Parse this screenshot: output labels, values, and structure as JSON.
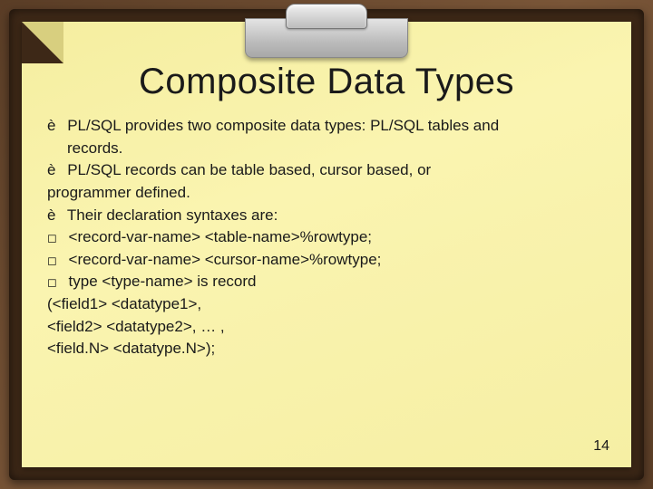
{
  "title": "Composite Data Types",
  "lines": {
    "l1a": "PL/SQL provides two composite data types: PL/SQL tables and",
    "l1b": "records.",
    "l2a": " PL/SQL records can be table based, cursor based, or",
    "l2b": "programmer defined.",
    "l3": "Their declaration syntaxes are:",
    "l4": "<record-var-name> <table-name>%rowtype;",
    "l5": "<record-var-name> <cursor-name>%rowtype;",
    "l6": "type <type-name> is record",
    "l7": "(<field1> <datatype1>,",
    "l8": "<field2> <datatype2>, … ,",
    "l9": "<field.N> <datatype.N>);"
  },
  "page_number": "14"
}
